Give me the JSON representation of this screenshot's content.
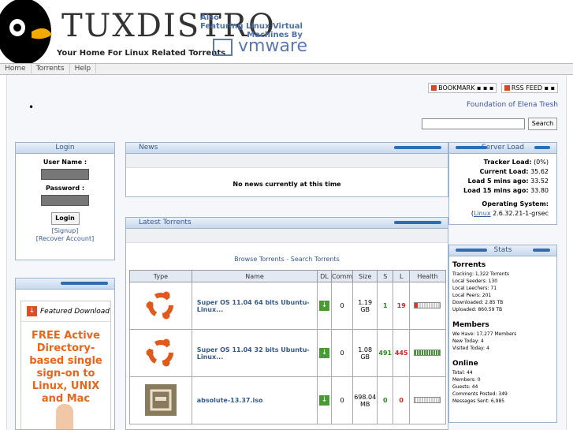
{
  "header": {
    "logo_text": "TUXDISTRO",
    "tagline": "Your Home For Linux Related Torrents",
    "vm_line1": "Also",
    "vm_line2": "Featuring Linux Virtual",
    "vm_line3": "Machines By",
    "vm_brand": "vmware"
  },
  "nav": [
    "Home",
    "Torrents",
    "Help"
  ],
  "share": {
    "bookmark": "BOOKMARK",
    "rss": "RSS FEED"
  },
  "foundation": "Foundation of Elena Tresh",
  "search": {
    "button": "Search",
    "value": ""
  },
  "login": {
    "title": "Login",
    "username_label": "User Name :",
    "password_label": "Password :",
    "button": "Login",
    "signup": "[Signup]",
    "recover": "[Recover Account]"
  },
  "ad": {
    "featured": "Featured Download",
    "headline": "FREE Active Directory-based single sign-on to Linux, UNIX and Mac"
  },
  "news": {
    "title": "News",
    "empty": "No news currently at this time"
  },
  "torrents": {
    "title": "Latest Torrents",
    "browse": "Browse Torrents - Search Torrents",
    "columns": [
      "Type",
      "Name",
      "DL",
      "Comm",
      "Size",
      "S",
      "L",
      "Health"
    ],
    "rows": [
      {
        "name": "Super OS 11.04 64 bits Ubuntu-Linux...",
        "comm": "0",
        "size": "1.19 GB",
        "s": "1",
        "l": "19",
        "health_pct": 10
      },
      {
        "name": "Super OS 11.04 32 bits Ubuntu-Linux...",
        "comm": "0",
        "size": "1.08 GB",
        "s": "491",
        "l": "445",
        "health_pct": 100
      },
      {
        "name": "absolute-13.37.iso",
        "comm": "0",
        "size": "698.04 MB",
        "s": "0",
        "l": "0",
        "health_pct": 0
      }
    ]
  },
  "server": {
    "title": "Server Load",
    "tracker_label": "Tracker Load:",
    "tracker_val": "(0%)",
    "current_label": "Current Load:",
    "current_val": "35.62",
    "five_label": "Load 5 mins ago:",
    "five_val": "33.52",
    "fifteen_label": "Load 15 mins ago:",
    "fifteen_val": "33.80",
    "os_label": "Operating System:",
    "os_link": "Linux",
    "os_val": "2.6.32.21-1-grsec"
  },
  "stats": {
    "title": "Stats",
    "torrents_h": "Torrents",
    "tracking": "Tracking: 1,322 Torrents",
    "seeders": "Local Seeders: 130",
    "leechers": "Local Leechers: 71",
    "peers": "Local Peers: 201",
    "downloaded": "Downloaded: 2.85 TB",
    "uploaded": "Uploaded: 860.59 TB",
    "members_h": "Members",
    "we_have": "We Have: 17,277 Members",
    "new_today": "New Today: 4",
    "visited": "Visited Today: 4",
    "online_h": "Online",
    "total": "Total: 44",
    "members": "Members: 0",
    "guests": "Guests: 44",
    "comments": "Comments Posted: 349",
    "messages": "Messages Sent: 6,985"
  },
  "colors": {
    "accent": "#2e6db4",
    "link": "#3b5998",
    "seed": "#2a8a1f",
    "leech": "#dd2222",
    "ad_orange": "#e8651a"
  }
}
